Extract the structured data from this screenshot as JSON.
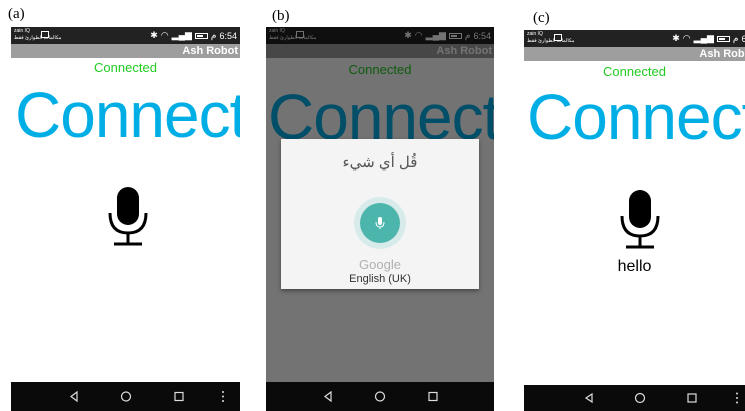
{
  "labels": [
    "(a)",
    "(b)",
    "(c)"
  ],
  "status": {
    "carrier_line1": "zain IQ",
    "carrier_line2": "مكالمات الطوارئ فقط",
    "time": "6:54",
    "time_suffix": "م"
  },
  "app": {
    "title": "Ash Robot",
    "connected_label": "Connected",
    "connect_button": "Connect"
  },
  "panel_c": {
    "recognized_text": "hello"
  },
  "dialog": {
    "prompt": "قُل أي شيء",
    "brand": "Google",
    "language": "English (UK)"
  },
  "colors": {
    "connected": "#22cc22",
    "connect": "#00aee6",
    "titlebar": "#9e9e9e",
    "mic_button": "#4db6ac"
  },
  "icons": [
    "microphone-icon",
    "back-icon",
    "home-icon",
    "recents-icon",
    "menu-icon"
  ]
}
